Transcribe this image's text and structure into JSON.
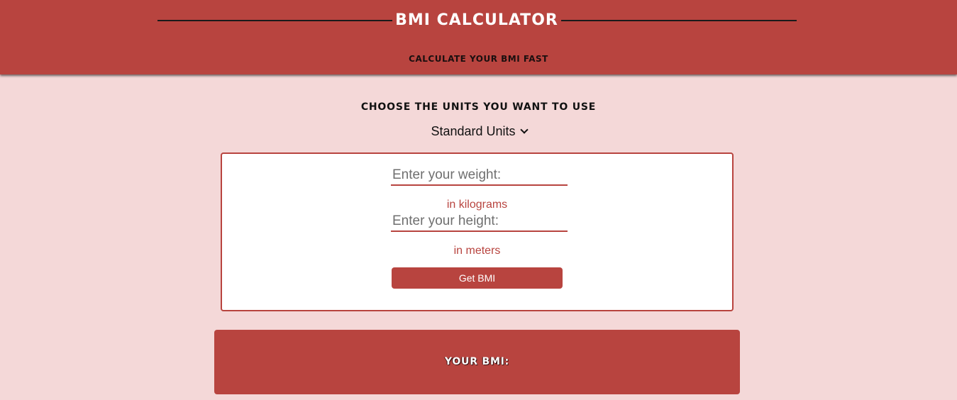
{
  "header": {
    "title": "BMI Calculator",
    "subtitle": "Calculate your BMI fast"
  },
  "units": {
    "label": "Choose the units you want to use",
    "selected": "Standard Units"
  },
  "form": {
    "weight_placeholder": "Enter your weight:",
    "weight_unit": "in kilograms",
    "height_placeholder": "Enter your height:",
    "height_unit": "in meters",
    "submit_label": "Get BMI"
  },
  "result": {
    "label": "Your BMI:"
  },
  "colors": {
    "accent": "#b8443f",
    "background": "#f4d8d8",
    "card": "#ffffff"
  },
  "icons": {
    "select_caret": "chevron-down-icon"
  }
}
